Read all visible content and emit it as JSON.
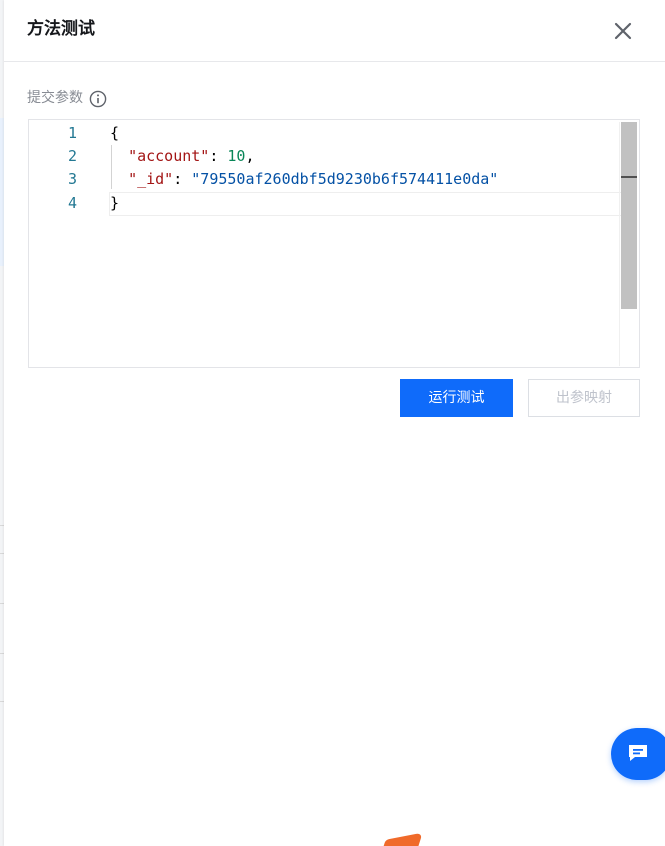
{
  "dialog": {
    "title": "方法测试",
    "close_icon": "close-icon"
  },
  "params": {
    "label": "提交参数",
    "info_icon": "info-circle-icon"
  },
  "editor": {
    "line_numbers": [
      "1",
      "2",
      "3",
      "4"
    ],
    "lines": {
      "l1": {
        "brace": "{"
      },
      "l2": {
        "key": "\"account\"",
        "sep": ": ",
        "value": "10",
        "trail": ","
      },
      "l3": {
        "key": "\"_id\"",
        "sep": ": ",
        "value": "\"79550af260dbf5d9230b6f574411e0da\""
      },
      "l4": {
        "brace": "}"
      }
    }
  },
  "actions": {
    "run_label": "运行测试",
    "map_label": "出参映射"
  },
  "chat": {
    "icon": "chat-bubble-icon"
  },
  "colors": {
    "primary": "#0f6bfa",
    "json_key": "#a31515",
    "json_number": "#098658",
    "json_string": "#0451a5",
    "line_number": "#237893"
  }
}
